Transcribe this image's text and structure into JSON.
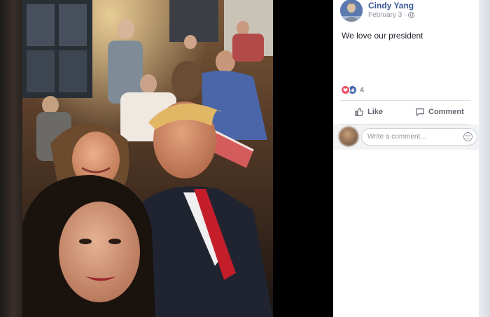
{
  "post": {
    "author": "Cindy Yang",
    "date": "February 3 ·",
    "text": "We love our president",
    "reaction_count": "4",
    "reactions": [
      "love",
      "like"
    ]
  },
  "actions": {
    "like_label": "Like",
    "comment_label": "Comment"
  },
  "comment_box": {
    "placeholder": "Write a comment..."
  },
  "icons": {
    "privacy": "globe-icon",
    "like": "thumbs-up-icon",
    "comment": "speech-bubble-icon",
    "emoji": "smiley-icon"
  },
  "colors": {
    "author_link": "#385898",
    "love_reaction": "#f25268",
    "like_reaction": "#4267b2",
    "muted_text": "#90949c"
  }
}
